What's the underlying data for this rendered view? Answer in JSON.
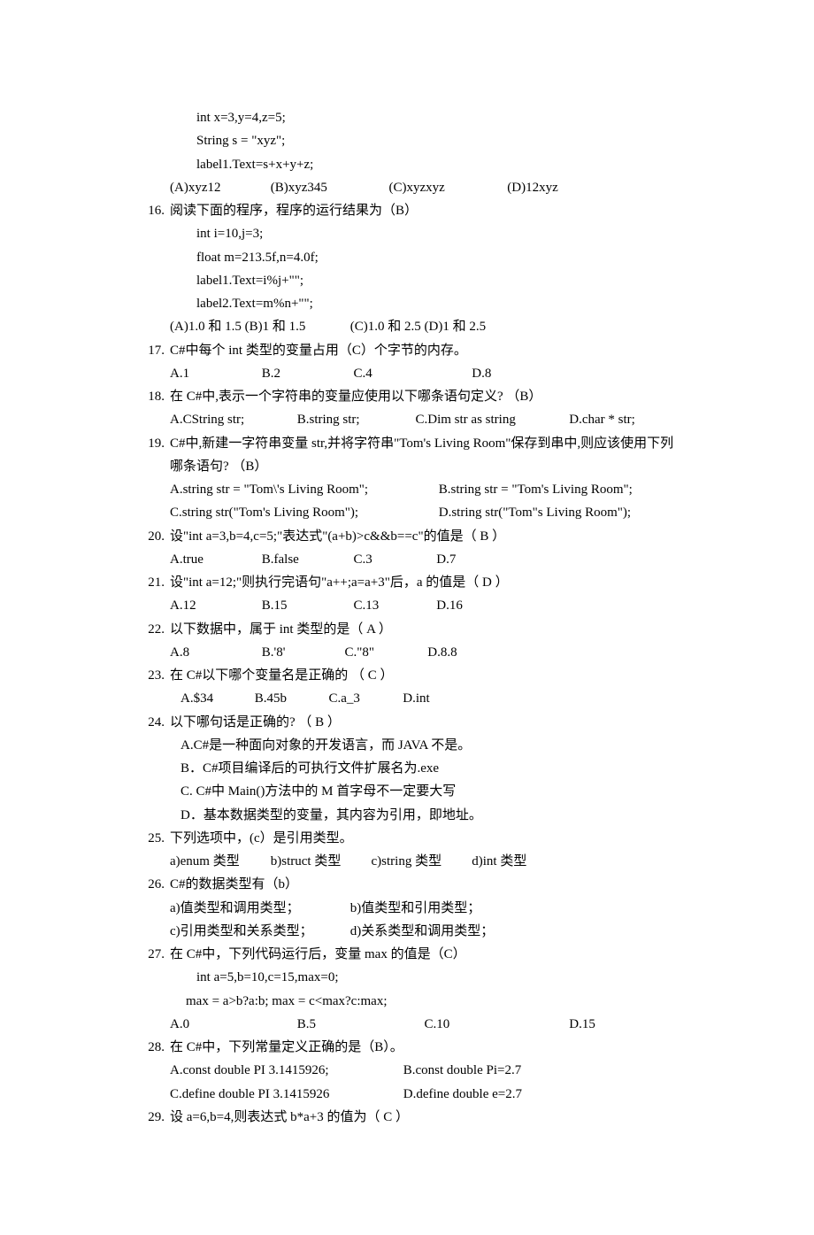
{
  "code15": {
    "l1": "int x=3,y=4,z=5;",
    "l2": "String s = \"xyz\";",
    "l3": "label1.Text=s+x+y+z;"
  },
  "opt15": {
    "a": "(A)xyz12",
    "b": "(B)xyz345",
    "c": "(C)xyzxyz",
    "d": "(D)12xyz"
  },
  "q16": {
    "num": "16.",
    "stem": "阅读下面的程序，程序的运行结果为（B）"
  },
  "code16": {
    "l1": "int i=10,j=3;",
    "l2": "float m=213.5f,n=4.0f;",
    "l3": "label1.Text=i%j+\"\";",
    "l4": "label2.Text=m%n+\"\";"
  },
  "opt16": {
    "a": "(A)1.0 和 1.5  (B)1 和 1.5",
    "c": "(C)1.0 和 2.5  (D)1 和 2.5"
  },
  "q17": {
    "num": "17.",
    "stem": "C#中每个  int  类型的变量占用（C）个字节的内存。"
  },
  "opt17": {
    "a": "A.1",
    "b": "B.2",
    "c": "C.4",
    "d": "D.8"
  },
  "q18": {
    "num": "18.",
    "stem": "在  C#中,表示一个字符串的变量应使用以下哪条语句定义?  （B）"
  },
  "opt18": {
    "a": "A.CString str;",
    "b": "B.string str;",
    "c": "C.Dim str as string",
    "d": "D.char * str;"
  },
  "q19": {
    "num": "19.",
    "stem": "C#中,新建一字符串变量  str,并将字符串\"Tom's Living Room\"保存到串中,则应该使用下列哪条语句?  （B）"
  },
  "opt19": {
    "a": "A.string str = \"Tom\\'s Living Room\";",
    "b": "B.string str = \"Tom's Living Room\";",
    "c": "C.string str(\"Tom's Living Room\");",
    "d": "D.string str(\"Tom\"s Living Room\");"
  },
  "q20": {
    "num": "20.",
    "stem": "设\"int a=3,b=4,c=5;\"表达式\"(a+b)>c&&b==c\"的值是（  B  ）"
  },
  "opt20": {
    "a": "A.true",
    "b": "B.false",
    "c": "C.3",
    "d": "D.7"
  },
  "q21": {
    "num": "21.",
    "stem": "设\"int a=12;\"则执行完语句\"a++;a=a+3\"后，a 的值是（  D  ）"
  },
  "opt21": {
    "a": "A.12",
    "b": "B.15",
    "c": "C.13",
    "d": "D.16"
  },
  "q22": {
    "num": "22.",
    "stem": "以下数据中，属于 int 类型的是（  A  ）"
  },
  "opt22": {
    "a": "A.8",
    "b": "B.'8'",
    "c": "C.\"8\"",
    "d": "D.8.8"
  },
  "q23": {
    "num": "23.",
    "stem": "在 C#以下哪个变量名是正确的    （  C  ）"
  },
  "opt23": {
    "a": "A.$34",
    "b": "B.45b",
    "c": "C.a_3",
    "d": "D.int"
  },
  "q24": {
    "num": "24.",
    "stem": "以下哪句话是正确的?   （  B  ）"
  },
  "opt24": {
    "a": "A.C#是一种面向对象的开发语言，而 JAVA 不是。",
    "b": "B．C#项目编译后的可执行文件扩展名为.exe",
    "c": "C. C#中 Main()方法中的 M 首字母不一定要大写",
    "d": "D．基本数据类型的变量，其内容为引用，即地址。"
  },
  "q25": {
    "num": "25.",
    "stem": "下列选项中，(c）是引用类型。"
  },
  "opt25": {
    "a": "a)enum 类型",
    "b": "b)struct 类型",
    "c": "c)string 类型",
    "d": "d)int 类型"
  },
  "q26": {
    "num": "26.",
    "stem": "C#的数据类型有（b）"
  },
  "opt26": {
    "a": "a)值类型和调用类型；",
    "b": "b)值类型和引用类型；",
    "c": "c)引用类型和关系类型；",
    "d": "d)关系类型和调用类型；"
  },
  "q27": {
    "num": "27.",
    "stem": "在 C#中，下列代码运行后，变量 max 的值是（C）"
  },
  "code27": {
    "l1": "int a=5,b=10,c=15,max=0;",
    "l2": "max = a>b?a:b;       max = c<max?c:max;"
  },
  "opt27": {
    "a": "A.0",
    "b": "B.5",
    "c": "C.10",
    "d": "D.15"
  },
  "q28": {
    "num": "28.",
    "stem": "在 C#中，下列常量定义正确的是（B）。"
  },
  "opt28": {
    "a": "A.const double PI 3.1415926;",
    "b": "B.const double Pi=2.7",
    "c": "C.define double PI 3.1415926",
    "d": "D.define double e=2.7"
  },
  "q29": {
    "num": "29.",
    "stem": "设 a=6,b=4,则表达式 b*a+3 的值为（    C    ）"
  }
}
